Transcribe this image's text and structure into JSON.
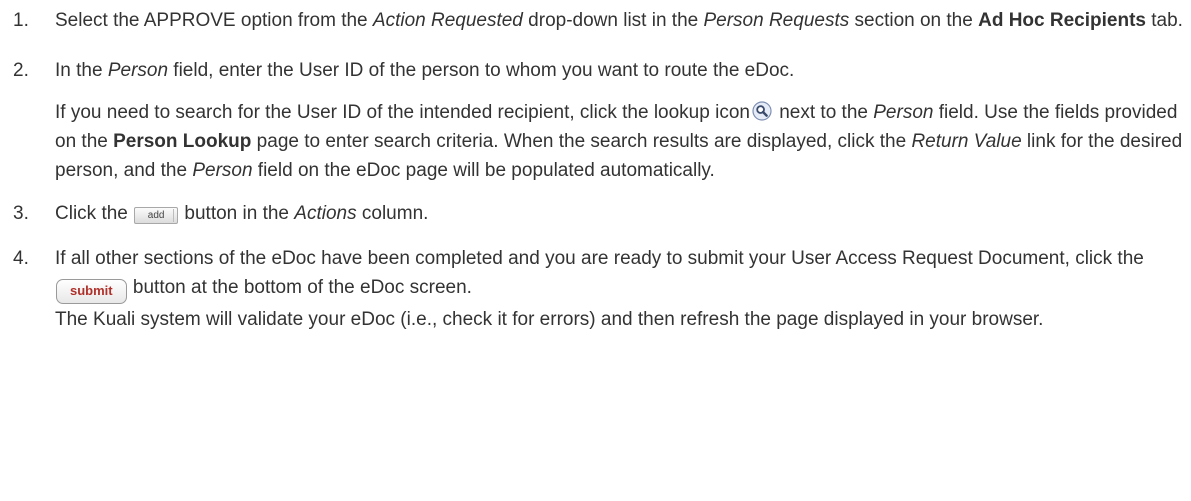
{
  "steps": [
    {
      "number": "1.",
      "p1": {
        "t1": "Select the APPROVE option from the ",
        "t2": "Action Requested",
        "t3": " drop-down list in the ",
        "t4": "Person Requests",
        "t5": " section on the ",
        "t6": "Ad Hoc Recipients",
        "t7": " tab."
      }
    },
    {
      "number": "2.",
      "p1": {
        "t1": "In the ",
        "t2": "Person",
        "t3": " field, enter the User ID of the person to whom you want to route the eDoc."
      },
      "p2": {
        "t1": "If you need to search for the User ID of the intended recipient, click the lookup icon",
        "t2": " next to the ",
        "t3": "Person",
        "t4": " field. Use the fields provided on the ",
        "t5": "Person Lookup",
        "t6": " page to enter search criteria. When the search results are displayed, click the ",
        "t7": "Return Value",
        "t8": " link for the desired person, and the ",
        "t9": "Person",
        "t10": " field on the eDoc page will be populated automatically."
      }
    },
    {
      "number": "3.",
      "p1": {
        "t1": "Click the ",
        "button": "add",
        "t2": " button in the ",
        "t3": "Actions",
        "t4": " column."
      }
    },
    {
      "number": "4.",
      "p1": {
        "t1": "If all other sections of the eDoc have been completed and you are ready to submit your User Access Request Document, click the ",
        "button": "submit",
        "t2": " button at the bottom of the eDoc screen."
      },
      "p2": {
        "t1": "The Kuali system will validate your eDoc (i.e., check it for errors) and then refresh the page displayed in your browser."
      }
    }
  ],
  "icons": {
    "lookup": "magnifier-lookup-icon"
  },
  "colors": {
    "text": "#333333",
    "submit_text": "#b0302a",
    "lookup_bg": "#e6ecf7",
    "lookup_border": "#7e8fb3"
  }
}
